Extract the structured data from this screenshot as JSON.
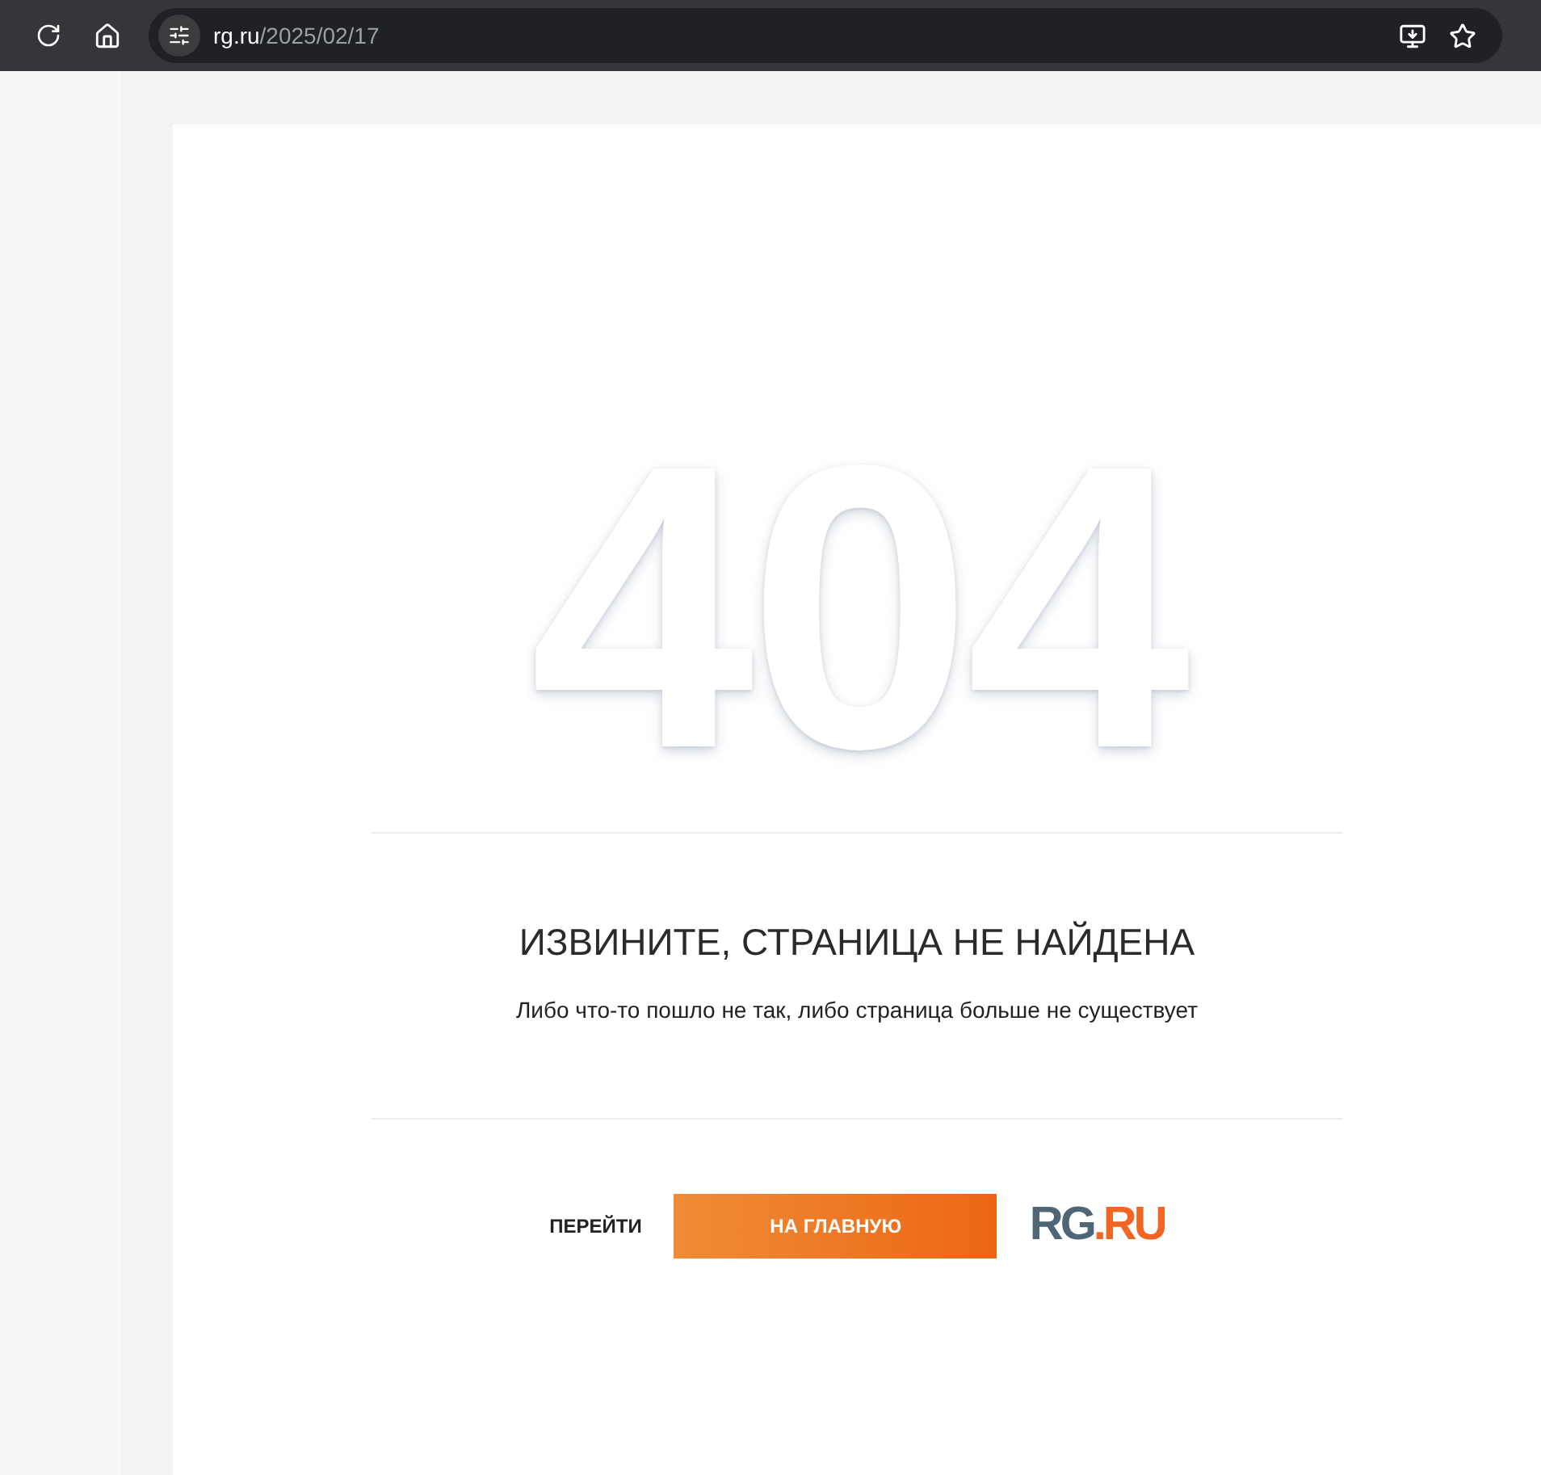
{
  "browser": {
    "url_host": "rg.ru",
    "url_path": "/2025/02/17"
  },
  "error": {
    "code": "404",
    "title": "ИЗВИНИТЕ, СТРАНИЦА НЕ НАЙДЕНА",
    "message": "Либо что-то пошло не так, либо страница больше не существует"
  },
  "actions": {
    "label": "ПЕРЕЙТИ",
    "button": "НА ГЛАВНУЮ"
  },
  "logo": {
    "left": "RG",
    "right": ".RU"
  }
}
